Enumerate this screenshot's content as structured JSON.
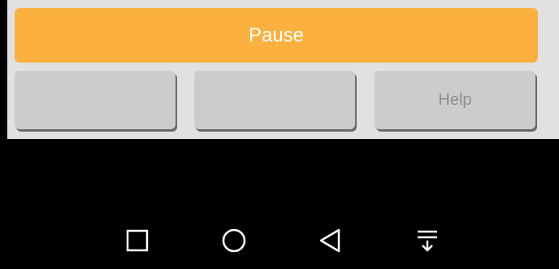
{
  "app": {
    "pause_label": "Pause",
    "actions": [
      {
        "label": ""
      },
      {
        "label": ""
      },
      {
        "label": "Help"
      }
    ]
  },
  "colors": {
    "pause_bg": "#fbb040",
    "panel_bg": "#e1e1e1",
    "button_bg": "#cccccc",
    "nav_bg": "#000000"
  },
  "navbar": {
    "icons": [
      "square-recents-icon",
      "circle-home-icon",
      "triangle-back-icon",
      "notification-pulldown-icon"
    ]
  }
}
